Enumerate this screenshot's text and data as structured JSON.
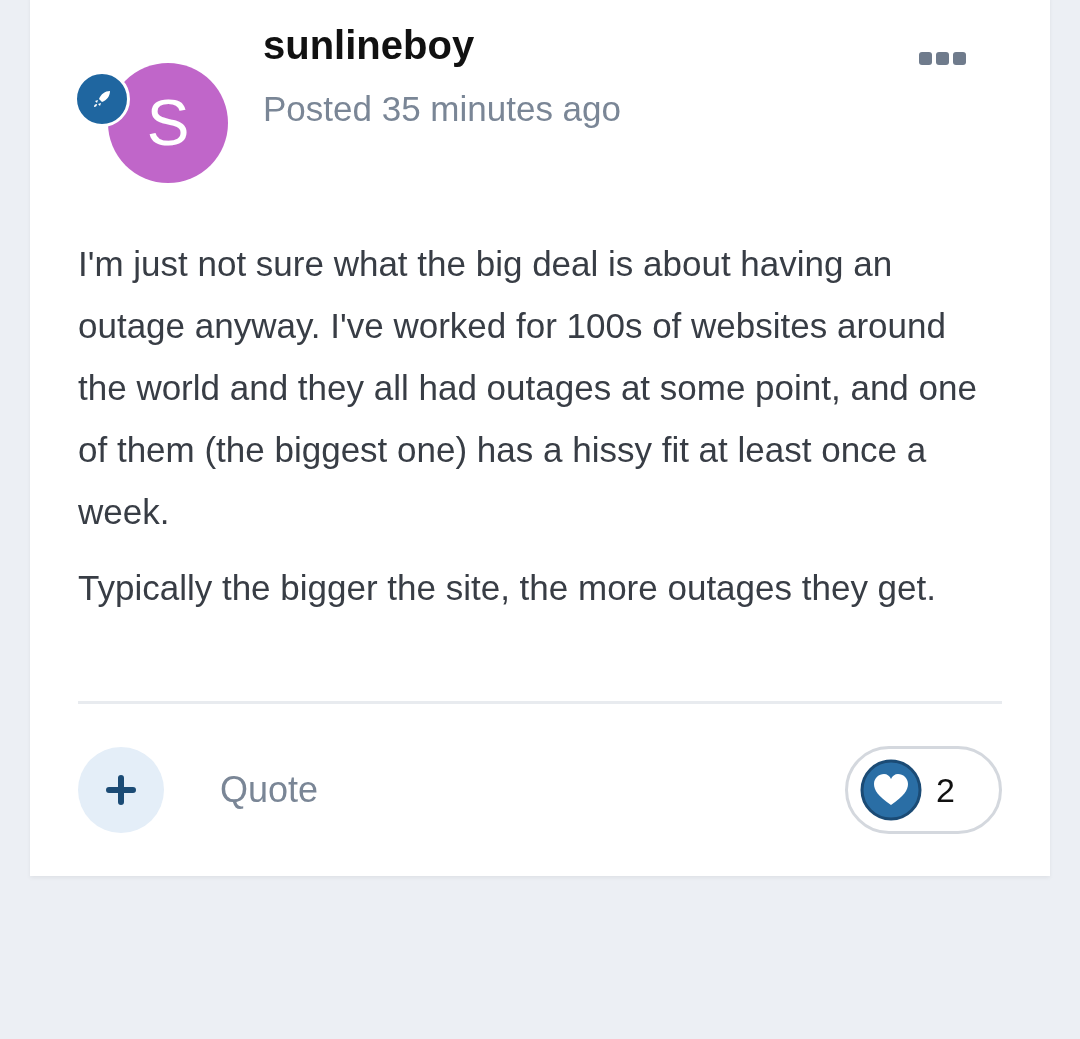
{
  "post": {
    "avatar_letter": "S",
    "author": "sunlineboy",
    "timestamp": "Posted 35 minutes ago",
    "body": [
      "I'm just not sure what the big deal is about having an outage anyway. I've worked for 100s of websites around the world and they all had outages at some point, and one of them (the biggest one) has a hissy fit at least once a week.",
      "Typically the bigger the site, the more outages they get."
    ],
    "quote_label": "Quote",
    "reaction_count": "2"
  }
}
